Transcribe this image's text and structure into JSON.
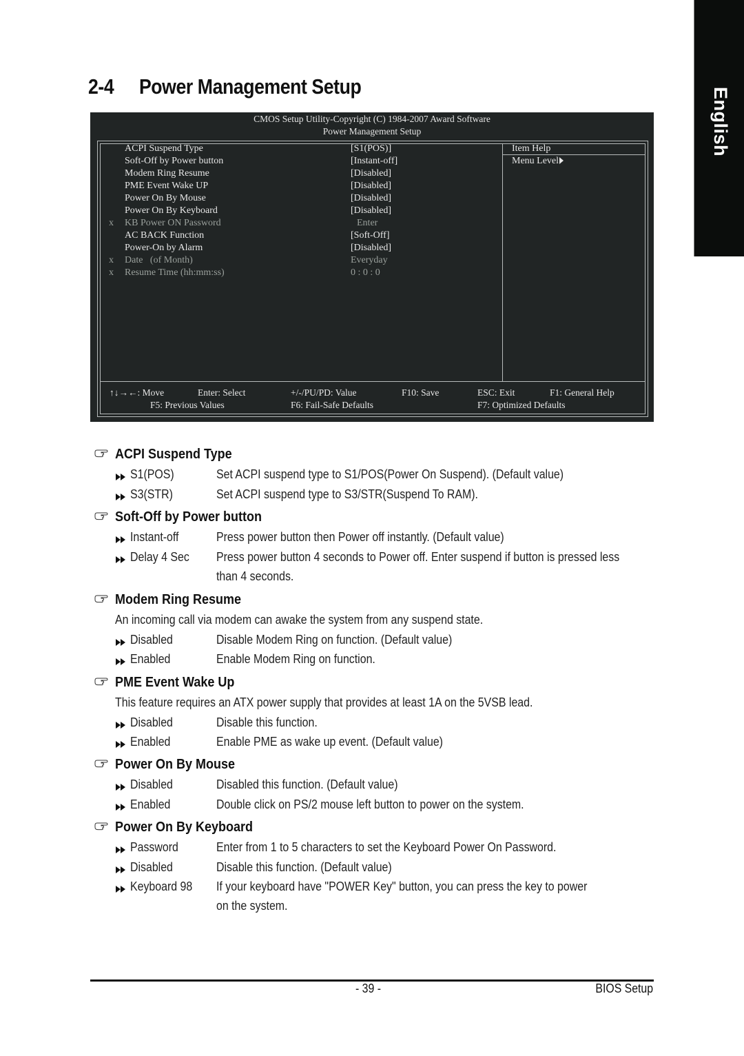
{
  "side_tab": {
    "label": "English"
  },
  "page_title": {
    "number": "2-4",
    "text": "Power Management Setup"
  },
  "bios": {
    "header_line1": "CMOS Setup Utility-Copyright (C) 1984-2007 Award Software",
    "header_line2": "Power Management Setup",
    "items": [
      {
        "mark": "",
        "label": "ACPI Suspend Type",
        "value": "[S1(POS)]",
        "enabled": true
      },
      {
        "mark": "",
        "label": "Soft-Off by Power button",
        "value": "[Instant-off]",
        "enabled": true
      },
      {
        "mark": "",
        "label": "Modem Ring Resume",
        "value": "[Disabled]",
        "enabled": true
      },
      {
        "mark": "",
        "label": "PME Event Wake UP",
        "value": "[Disabled]",
        "enabled": true
      },
      {
        "mark": "",
        "label": "Power On By Mouse",
        "value": "[Disabled]",
        "enabled": true
      },
      {
        "mark": "",
        "label": "Power On By Keyboard",
        "value": "[Disabled]",
        "enabled": true
      },
      {
        "mark": "x",
        "label": "KB Power ON Password",
        "value": "Enter",
        "enabled": false
      },
      {
        "mark": "",
        "label": "AC BACK Function",
        "value": "[Soft-Off]",
        "enabled": true
      },
      {
        "mark": "",
        "label": "Power-On by Alarm",
        "value": "[Disabled]",
        "enabled": true
      },
      {
        "mark": "x",
        "label": "Date   (of Month)",
        "value": "Everyday",
        "enabled": false
      },
      {
        "mark": "x",
        "label": "Resume Time (hh:mm:ss)",
        "value": "0 : 0 : 0",
        "enabled": false
      }
    ],
    "help": {
      "title": "Item Help",
      "menu_level": "Menu Level"
    },
    "keys": {
      "move": "↑↓→←: Move",
      "select": "Enter: Select",
      "value": "+/-/PU/PD: Value",
      "save": "F10: Save",
      "exit": "ESC: Exit",
      "general_help": "F1: General Help",
      "previous": "F5: Previous Values",
      "failsafe": "F6: Fail-Safe Defaults",
      "optimized": "F7: Optimized Defaults"
    }
  },
  "sections": [
    {
      "title": "ACPI Suspend Type",
      "intro": "",
      "options": [
        {
          "name": "S1(POS)",
          "text": "Set ACPI suspend type to S1/POS(Power On Suspend). (Default value)",
          "text2": ""
        },
        {
          "name": "S3(STR)",
          "text": "Set ACPI suspend type to S3/STR(Suspend To RAM).",
          "text2": ""
        }
      ]
    },
    {
      "title": "Soft-Off by Power button",
      "intro": "",
      "options": [
        {
          "name": "Instant-off",
          "text": "Press power button then Power off instantly. (Default value)",
          "text2": ""
        },
        {
          "name": "Delay 4 Sec",
          "text": "Press power button 4 seconds to Power off. Enter suspend if button is pressed less",
          "text2": "than  4 seconds."
        }
      ]
    },
    {
      "title": "Modem Ring Resume",
      "intro": "An incoming call via modem can awake the system from any suspend state.",
      "options": [
        {
          "name": "Disabled",
          "text": "Disable Modem Ring on function. (Default value)",
          "text2": ""
        },
        {
          "name": "Enabled",
          "text": "Enable Modem Ring on function.",
          "text2": ""
        }
      ]
    },
    {
      "title": "PME Event Wake Up",
      "intro": "This feature requires an ATX power supply that provides at least 1A on the 5VSB lead.",
      "options": [
        {
          "name": "Disabled",
          "text": "Disable this function.",
          "text2": ""
        },
        {
          "name": "Enabled",
          "text": "Enable PME as wake up event. (Default value)",
          "text2": ""
        }
      ]
    },
    {
      "title": "Power On By Mouse",
      "intro": "",
      "options": [
        {
          "name": "Disabled",
          "text": "Disabled this function. (Default value)",
          "text2": ""
        },
        {
          "name": "Enabled",
          "text": "Double click on PS/2 mouse left button to power on the system.",
          "text2": ""
        }
      ]
    },
    {
      "title": "Power On By Keyboard",
      "intro": "",
      "options": [
        {
          "name": "Password",
          "text": "Enter from 1 to 5 characters to set the Keyboard Power On Password.",
          "text2": ""
        },
        {
          "name": "Disabled",
          "text": "Disable this function. (Default value)",
          "text2": ""
        },
        {
          "name": "Keyboard 98",
          "text": "If your keyboard have \"POWER Key\" button, you can press the key to power",
          "text2": "on the system."
        }
      ]
    }
  ],
  "footer": {
    "page": "- 39 -",
    "chapter": "BIOS Setup"
  }
}
